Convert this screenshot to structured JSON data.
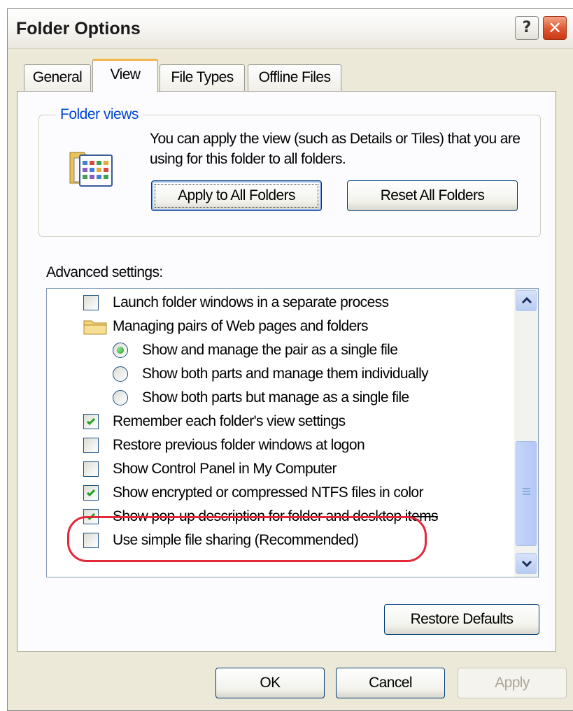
{
  "window": {
    "title": "Folder Options",
    "help_label": "?",
    "close_label": "✕"
  },
  "tabs": [
    {
      "label": "General",
      "active": false
    },
    {
      "label": "View",
      "active": true
    },
    {
      "label": "File Types",
      "active": false
    },
    {
      "label": "Offline Files",
      "active": false
    }
  ],
  "folder_views": {
    "group_label": "Folder views",
    "description": "You can apply the view (such as Details or Tiles) that you are using for this folder to all folders.",
    "apply_button": "Apply to All Folders",
    "reset_button": "Reset All Folders",
    "icon": "folder-views-icon"
  },
  "advanced": {
    "label": "Advanced settings:",
    "items": [
      {
        "type": "checkbox",
        "checked": false,
        "label": "Launch folder windows in a separate process"
      },
      {
        "type": "folder",
        "label": "Managing pairs of Web pages and folders"
      },
      {
        "type": "radio",
        "checked": true,
        "label": "Show and manage the pair as a single file"
      },
      {
        "type": "radio",
        "checked": false,
        "label": "Show both parts and manage them individually"
      },
      {
        "type": "radio",
        "checked": false,
        "label": "Show both parts but manage as a single file"
      },
      {
        "type": "checkbox",
        "checked": true,
        "label": "Remember each folder's view settings"
      },
      {
        "type": "checkbox",
        "checked": false,
        "label": "Restore previous folder windows at logon"
      },
      {
        "type": "checkbox",
        "checked": false,
        "label": "Show Control Panel in My Computer"
      },
      {
        "type": "checkbox",
        "checked": true,
        "label": "Show encrypted or compressed NTFS files in color"
      },
      {
        "type": "checkbox",
        "checked": true,
        "label": "Show pop-up description for folder and desktop items"
      },
      {
        "type": "checkbox",
        "checked": false,
        "label": "Use simple file sharing (Recommended)"
      }
    ],
    "restore_defaults": "Restore Defaults"
  },
  "footer": {
    "ok": "OK",
    "cancel": "Cancel",
    "apply": "Apply"
  },
  "colors": {
    "highlight": "#e4283a",
    "group_label": "#0046d5",
    "check": "#21a121"
  }
}
